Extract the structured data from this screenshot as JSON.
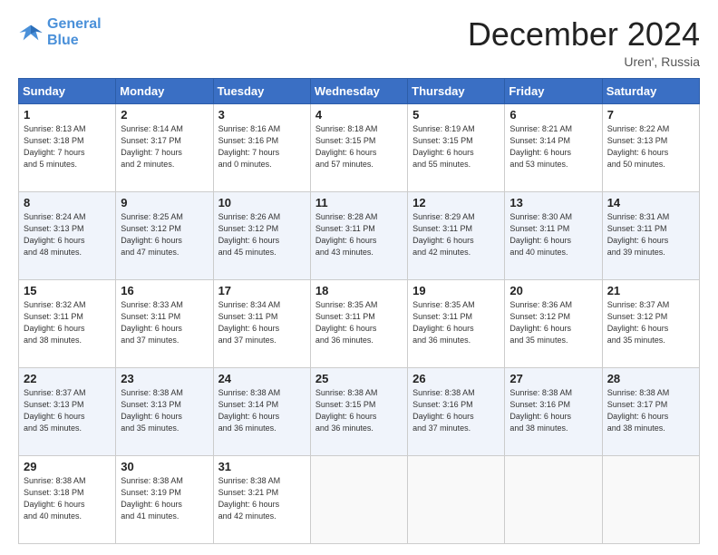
{
  "header": {
    "logo_line1": "General",
    "logo_line2": "Blue",
    "month": "December 2024",
    "location": "Uren', Russia"
  },
  "weekdays": [
    "Sunday",
    "Monday",
    "Tuesday",
    "Wednesday",
    "Thursday",
    "Friday",
    "Saturday"
  ],
  "weeks": [
    [
      {
        "day": "1",
        "info": "Sunrise: 8:13 AM\nSunset: 3:18 PM\nDaylight: 7 hours\nand 5 minutes."
      },
      {
        "day": "2",
        "info": "Sunrise: 8:14 AM\nSunset: 3:17 PM\nDaylight: 7 hours\nand 2 minutes."
      },
      {
        "day": "3",
        "info": "Sunrise: 8:16 AM\nSunset: 3:16 PM\nDaylight: 7 hours\nand 0 minutes."
      },
      {
        "day": "4",
        "info": "Sunrise: 8:18 AM\nSunset: 3:15 PM\nDaylight: 6 hours\nand 57 minutes."
      },
      {
        "day": "5",
        "info": "Sunrise: 8:19 AM\nSunset: 3:15 PM\nDaylight: 6 hours\nand 55 minutes."
      },
      {
        "day": "6",
        "info": "Sunrise: 8:21 AM\nSunset: 3:14 PM\nDaylight: 6 hours\nand 53 minutes."
      },
      {
        "day": "7",
        "info": "Sunrise: 8:22 AM\nSunset: 3:13 PM\nDaylight: 6 hours\nand 50 minutes."
      }
    ],
    [
      {
        "day": "8",
        "info": "Sunrise: 8:24 AM\nSunset: 3:13 PM\nDaylight: 6 hours\nand 48 minutes."
      },
      {
        "day": "9",
        "info": "Sunrise: 8:25 AM\nSunset: 3:12 PM\nDaylight: 6 hours\nand 47 minutes."
      },
      {
        "day": "10",
        "info": "Sunrise: 8:26 AM\nSunset: 3:12 PM\nDaylight: 6 hours\nand 45 minutes."
      },
      {
        "day": "11",
        "info": "Sunrise: 8:28 AM\nSunset: 3:11 PM\nDaylight: 6 hours\nand 43 minutes."
      },
      {
        "day": "12",
        "info": "Sunrise: 8:29 AM\nSunset: 3:11 PM\nDaylight: 6 hours\nand 42 minutes."
      },
      {
        "day": "13",
        "info": "Sunrise: 8:30 AM\nSunset: 3:11 PM\nDaylight: 6 hours\nand 40 minutes."
      },
      {
        "day": "14",
        "info": "Sunrise: 8:31 AM\nSunset: 3:11 PM\nDaylight: 6 hours\nand 39 minutes."
      }
    ],
    [
      {
        "day": "15",
        "info": "Sunrise: 8:32 AM\nSunset: 3:11 PM\nDaylight: 6 hours\nand 38 minutes."
      },
      {
        "day": "16",
        "info": "Sunrise: 8:33 AM\nSunset: 3:11 PM\nDaylight: 6 hours\nand 37 minutes."
      },
      {
        "day": "17",
        "info": "Sunrise: 8:34 AM\nSunset: 3:11 PM\nDaylight: 6 hours\nand 37 minutes."
      },
      {
        "day": "18",
        "info": "Sunrise: 8:35 AM\nSunset: 3:11 PM\nDaylight: 6 hours\nand 36 minutes."
      },
      {
        "day": "19",
        "info": "Sunrise: 8:35 AM\nSunset: 3:11 PM\nDaylight: 6 hours\nand 36 minutes."
      },
      {
        "day": "20",
        "info": "Sunrise: 8:36 AM\nSunset: 3:12 PM\nDaylight: 6 hours\nand 35 minutes."
      },
      {
        "day": "21",
        "info": "Sunrise: 8:37 AM\nSunset: 3:12 PM\nDaylight: 6 hours\nand 35 minutes."
      }
    ],
    [
      {
        "day": "22",
        "info": "Sunrise: 8:37 AM\nSunset: 3:13 PM\nDaylight: 6 hours\nand 35 minutes."
      },
      {
        "day": "23",
        "info": "Sunrise: 8:38 AM\nSunset: 3:13 PM\nDaylight: 6 hours\nand 35 minutes."
      },
      {
        "day": "24",
        "info": "Sunrise: 8:38 AM\nSunset: 3:14 PM\nDaylight: 6 hours\nand 36 minutes."
      },
      {
        "day": "25",
        "info": "Sunrise: 8:38 AM\nSunset: 3:15 PM\nDaylight: 6 hours\nand 36 minutes."
      },
      {
        "day": "26",
        "info": "Sunrise: 8:38 AM\nSunset: 3:16 PM\nDaylight: 6 hours\nand 37 minutes."
      },
      {
        "day": "27",
        "info": "Sunrise: 8:38 AM\nSunset: 3:16 PM\nDaylight: 6 hours\nand 38 minutes."
      },
      {
        "day": "28",
        "info": "Sunrise: 8:38 AM\nSunset: 3:17 PM\nDaylight: 6 hours\nand 38 minutes."
      }
    ],
    [
      {
        "day": "29",
        "info": "Sunrise: 8:38 AM\nSunset: 3:18 PM\nDaylight: 6 hours\nand 40 minutes."
      },
      {
        "day": "30",
        "info": "Sunrise: 8:38 AM\nSunset: 3:19 PM\nDaylight: 6 hours\nand 41 minutes."
      },
      {
        "day": "31",
        "info": "Sunrise: 8:38 AM\nSunset: 3:21 PM\nDaylight: 6 hours\nand 42 minutes."
      },
      null,
      null,
      null,
      null
    ]
  ]
}
